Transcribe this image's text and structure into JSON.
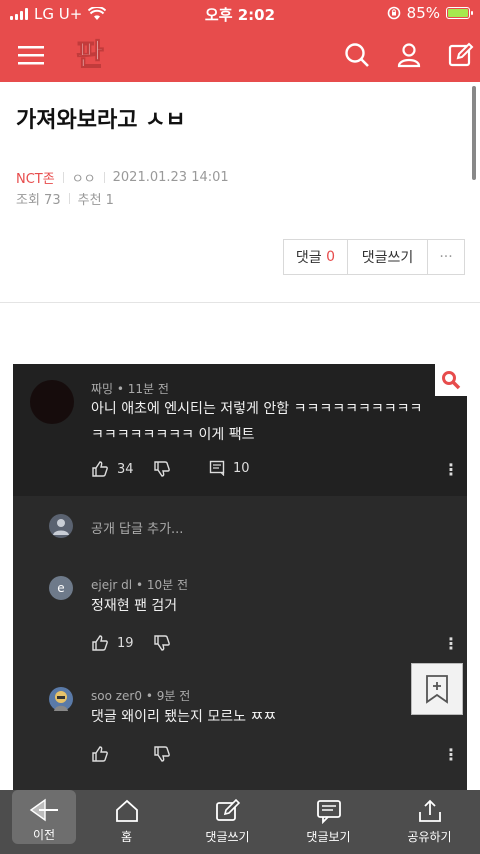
{
  "status_bar": {
    "carrier": "LG U+",
    "time": "오후 2:02",
    "battery": "85%"
  },
  "header": {
    "logo_text": "판"
  },
  "post": {
    "title": "가져와보라고 ㅅㅂ",
    "author": "NCT존",
    "author_tag": "ㅇㅇ",
    "datetime": "2021.01.23 14:01",
    "views": "조회 73",
    "recommend": "추천 1"
  },
  "actions": {
    "comment_label": "댓글",
    "comment_count": "0",
    "write_label": "댓글쓰기",
    "more": "···"
  },
  "embed": {
    "comments": [
      {
        "meta": "짜밍 • 11분 전",
        "text_line1": "아니 애초에 엔시티는 저렇게 안함 ㅋㅋㅋㅋㅋㅋㅋㅋㅋㅋ",
        "text_line2": "ㅋㅋㅋㅋㅋㅋㅋㅋ 이게 팩트",
        "likes": "34",
        "replies": "10"
      }
    ],
    "reply_placeholder": "공개 답글 추가...",
    "replies": [
      {
        "meta": "ejejr dl • 10분 전",
        "text": "정재현 팬 검거",
        "likes": "19",
        "avatar_letter": "e"
      },
      {
        "meta": "soo zer0 • 9분 전",
        "text": "댓글 왜이리 됐는지 모르노 ㅉㅉ"
      }
    ]
  },
  "bottom_nav": {
    "back": "이전",
    "home": "홈",
    "write": "댓글쓰기",
    "view": "댓글보기",
    "share": "공유하기"
  },
  "colors": {
    "brand": "#e74c4c",
    "dark_bg": "#212121",
    "nav_bg": "#4d4d4d"
  }
}
